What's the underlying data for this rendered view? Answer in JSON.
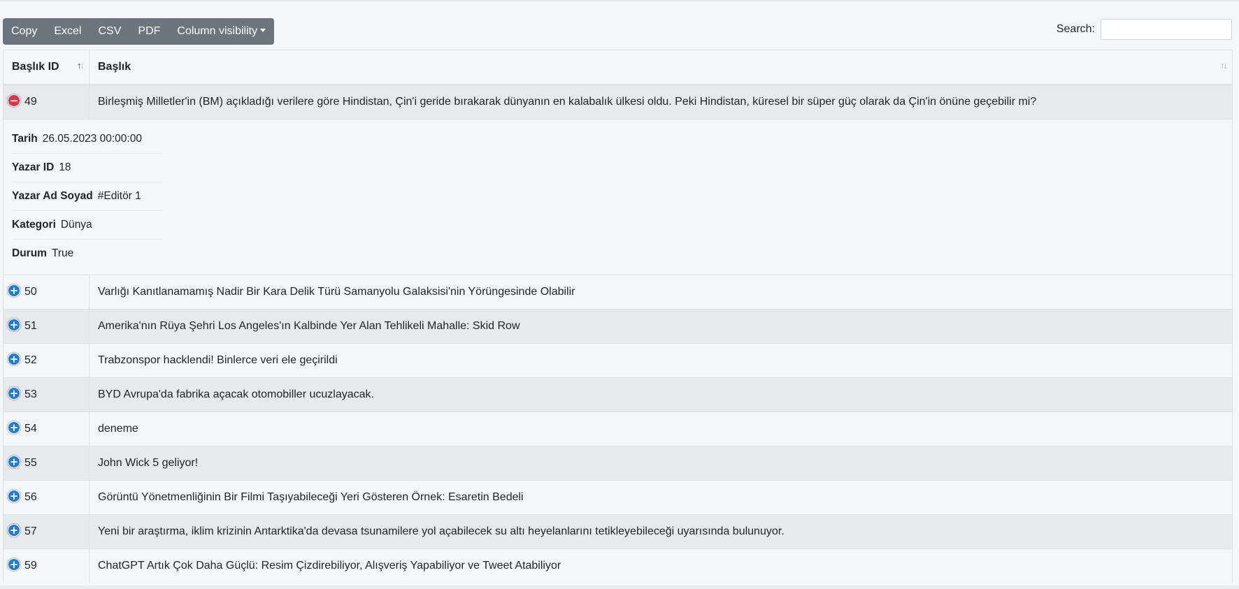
{
  "toolbar": {
    "buttons": [
      "Copy",
      "Excel",
      "CSV",
      "PDF",
      "Column visibility"
    ]
  },
  "search": {
    "label": "Search:",
    "value": ""
  },
  "table": {
    "columns": [
      "Başlık ID",
      "Başlık"
    ],
    "rows": [
      {
        "id": "49",
        "title": "Birleşmiş Milletler'in (BM) açıkladığı verilere göre Hindistan, Çin'i geride bırakarak dünyanın en kalabalık ülkesi oldu. Peki Hindistan, küresel bir süper güç olarak da Çin'in önüne geçebilir mi?",
        "expanded": true
      },
      {
        "id": "50",
        "title": "Varlığı Kanıtlanamamış Nadir Bir Kara Delik Türü Samanyolu Galaksisi'nin Yörüngesinde Olabilir",
        "expanded": false
      },
      {
        "id": "51",
        "title": "Amerika'nın Rüya Şehri Los Angeles'ın Kalbinde Yer Alan Tehlikeli Mahalle: Skid Row",
        "expanded": false
      },
      {
        "id": "52",
        "title": "Trabzonspor hacklendi! Binlerce veri ele geçirildi",
        "expanded": false
      },
      {
        "id": "53",
        "title": "BYD Avrupa'da fabrika açacak otomobiller ucuzlayacak.",
        "expanded": false
      },
      {
        "id": "54",
        "title": "deneme",
        "expanded": false
      },
      {
        "id": "55",
        "title": "John Wick 5 geliyor!",
        "expanded": false
      },
      {
        "id": "56",
        "title": "Görüntü Yönetmenliğinin Bir Filmi Taşıyabileceği Yeri Gösteren Örnek: Esaretin Bedeli",
        "expanded": false
      },
      {
        "id": "57",
        "title": "Yeni bir araştırma, iklim krizinin Antarktika'da devasa tsunamilere yol açabilecek su altı heyelanlarını tetikleyebileceği uyarısında bulunuyor.",
        "expanded": false
      },
      {
        "id": "59",
        "title": "ChatGPT Artık Çok Daha Güçlü: Resim Çizdirebiliyor, Alışveriş Yapabiliyor ve Tweet Atabiliyor",
        "expanded": false
      }
    ],
    "details": [
      {
        "label": "Tarih",
        "value": "26.05.2023 00:00:00"
      },
      {
        "label": "Yazar ID",
        "value": "18"
      },
      {
        "label": "Yazar Ad Soyad",
        "value": "#Editör 1"
      },
      {
        "label": "Kategori",
        "value": "Dünya"
      },
      {
        "label": "Durum",
        "value": "True"
      }
    ]
  },
  "icons": {
    "expand": "plus-circle-icon",
    "collapse": "minus-circle-icon",
    "sort": "sort-arrows-icon"
  },
  "colors": {
    "button_bg": "#6c757d",
    "expand_icon": "#1e7bd9",
    "collapse_icon": "#dc3545"
  }
}
